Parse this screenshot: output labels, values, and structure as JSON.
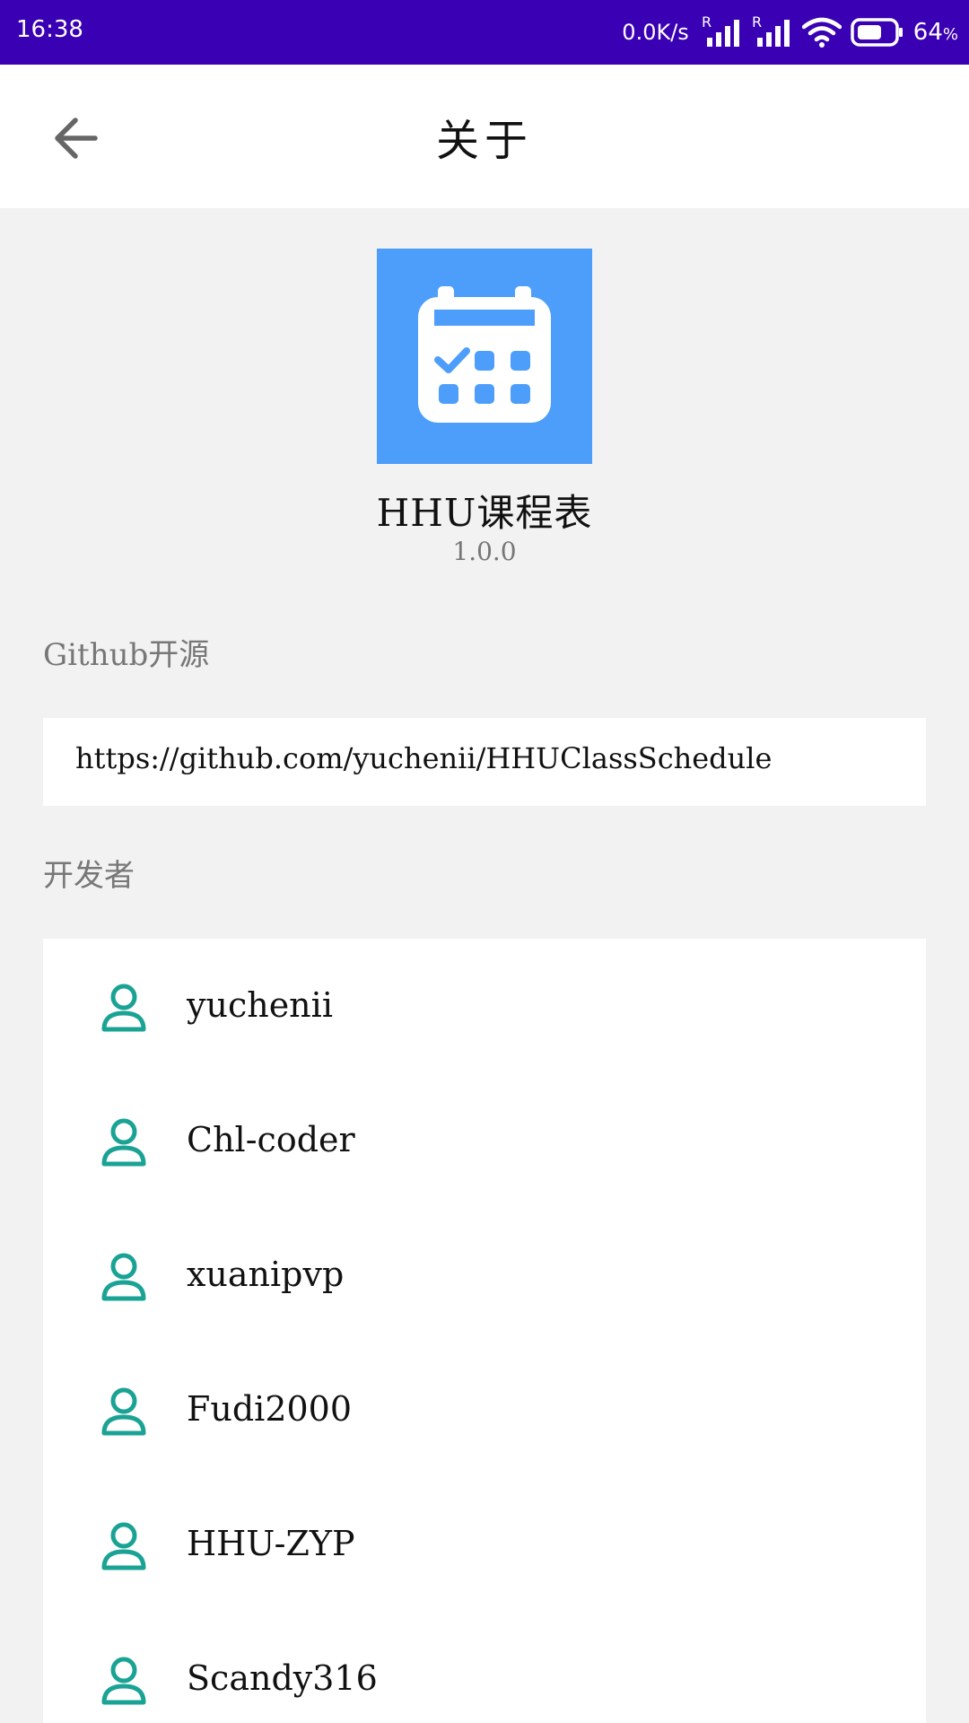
{
  "status_bar": {
    "time": "16:38",
    "net_speed": "0.0K/s",
    "signal_1_label": "R",
    "signal_2_label": "R",
    "battery_percent": "64",
    "battery_unit": "%"
  },
  "toolbar": {
    "title": "关于",
    "back_icon": "arrow-left-icon"
  },
  "app": {
    "icon": "calendar-icon",
    "icon_bg": "#4d9efb",
    "name": "HHU课程表",
    "version": "1.0.0"
  },
  "github": {
    "label": "Github开源",
    "url": "https://github.com/yuchenii/HHUClassSchedule"
  },
  "developers": {
    "label": "开发者",
    "icon": "person-icon",
    "icon_color": "#1aa394",
    "items": [
      {
        "name": "yuchenii"
      },
      {
        "name": "Chl-coder"
      },
      {
        "name": "xuanipvp"
      },
      {
        "name": "Fudi2000"
      },
      {
        "name": "HHU-ZYP"
      },
      {
        "name": "Scandy316"
      }
    ]
  },
  "colors": {
    "status_bar": "#3a00b3",
    "background": "#f2f2f2"
  }
}
